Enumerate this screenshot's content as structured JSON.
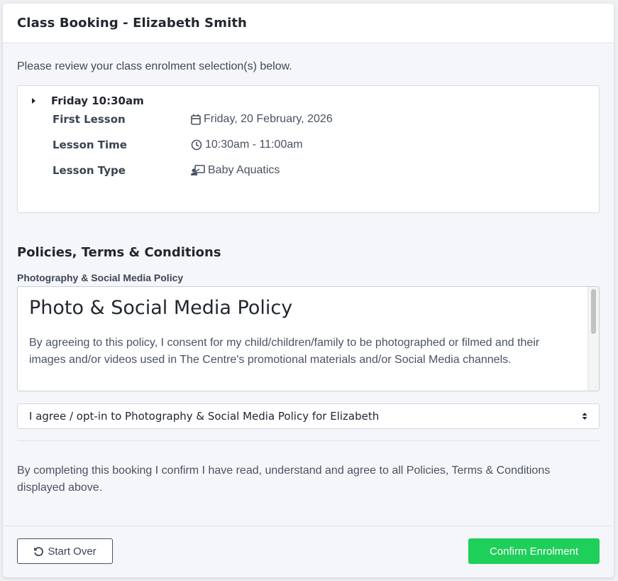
{
  "header": {
    "title": "Class Booking - Elizabeth Smith"
  },
  "intro": "Please review your class enrolment selection(s) below.",
  "class": {
    "name": "Friday 10:30am",
    "details": [
      {
        "label": "First Lesson",
        "value": "Friday, 20 February, 2026",
        "icon": "calendar-icon"
      },
      {
        "label": "Lesson Time",
        "value": "10:30am - 11:00am",
        "icon": "clock-icon"
      },
      {
        "label": "Lesson Type",
        "value": "Baby Aquatics",
        "icon": "teacher-icon"
      }
    ]
  },
  "policies": {
    "section_title": "Policies, Terms & Conditions",
    "policy_label": "Photography & Social Media Policy",
    "policy_heading": "Photo & Social Media Policy",
    "policy_text": "By agreeing to this policy, I consent for my child/children/family to be photographed or filmed and their images and/or videos used in The Centre's promotional materials and/or Social Media channels.",
    "select_value": "I agree / opt-in to Photography & Social Media Policy for Elizabeth"
  },
  "confirm_text": "By completing this booking I confirm I have read, understand and agree to all Policies, Terms & Conditions displayed above.",
  "footer": {
    "start_over_label": "Start Over",
    "confirm_label": "Confirm Enrolment"
  },
  "colors": {
    "confirm_button": "#1ecf5a"
  }
}
